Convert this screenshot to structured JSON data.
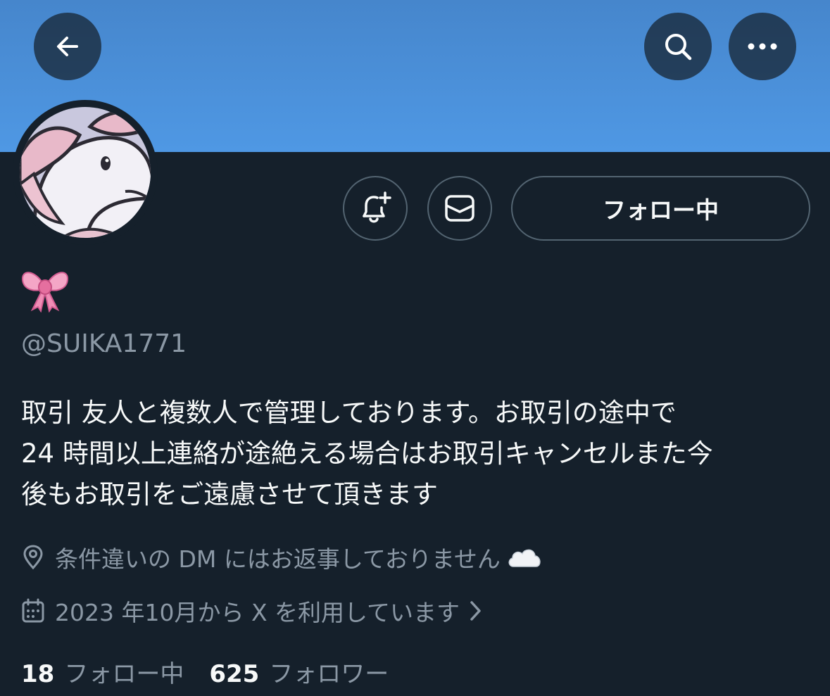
{
  "header": {
    "banner_color": "#4a90dd",
    "back_icon": "arrow-left-icon",
    "search_icon": "search-icon",
    "more_icon": "more-horizontal-icon"
  },
  "profile": {
    "display_name_emoji": "🎀",
    "handle": "@SUIKA1771",
    "bio_lines": [
      "取引 友人と複数人で管理しております。お取引の途中で",
      "24 時間以上連絡が途絶える場合はお取引キャンセルまた今",
      "後もお取引をご遠慮させて頂きます"
    ],
    "location": "条件違いの DM にはお返事しておりません",
    "location_emoji": "☁️",
    "joined": "2023 年10月から X を利用しています"
  },
  "actions": {
    "notify_icon": "bell-plus-icon",
    "dm_icon": "envelope-icon",
    "follow_label": "フォロー中"
  },
  "stats": {
    "following_count": "18",
    "following_label": "フォロー中",
    "followers_count": "625",
    "followers_label": "フォロワー"
  },
  "colors": {
    "background": "#15202b",
    "text_primary": "#f7f9f9",
    "text_secondary": "#8b98a5",
    "border": "#536471"
  }
}
